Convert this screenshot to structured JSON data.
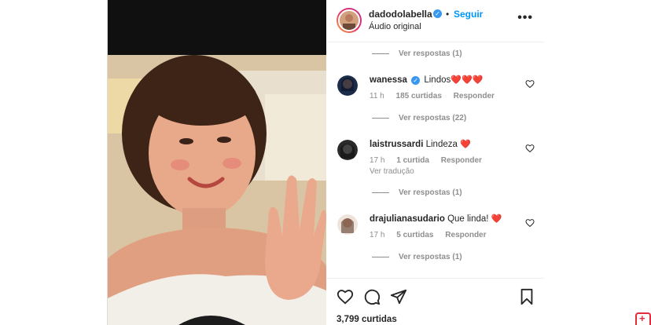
{
  "post": {
    "author": "dadodolabella",
    "follow_label": "Seguir",
    "dot": "•",
    "audio": "Áudio original",
    "more_label": "•••"
  },
  "comments": [
    {
      "replies_label": "Ver respostas (1)"
    },
    {
      "user": "wanessa",
      "verified": true,
      "text": "Lindos",
      "emoji": "❤️❤️❤️",
      "time": "11 h",
      "likes": "185 curtidas",
      "reply": "Responder",
      "replies_label": "Ver respostas (22)"
    },
    {
      "user": "laistrussardi",
      "text": "Lindeza",
      "emoji": "❤️",
      "time": "17 h",
      "likes": "1 curtida",
      "reply": "Responder",
      "translate": "Ver tradução",
      "replies_label": "Ver respostas (1)"
    },
    {
      "user": "drajulianasudario",
      "text": "Que linda!",
      "emoji": "❤️",
      "time": "17 h",
      "likes": "5 curtidas",
      "reply": "Responder",
      "replies_label": "Ver respostas (1)"
    }
  ],
  "footer": {
    "likes": "3,799 curtidas"
  },
  "icons": {
    "like": "heart-icon",
    "comment": "comment-icon",
    "share": "paper-plane-icon",
    "save": "bookmark-icon",
    "corner": "plus-badge-icon"
  },
  "colors": {
    "link": "#0095f6",
    "verified": "#3897f0",
    "muted": "#8e8e8e",
    "heart": "#e0242c"
  }
}
